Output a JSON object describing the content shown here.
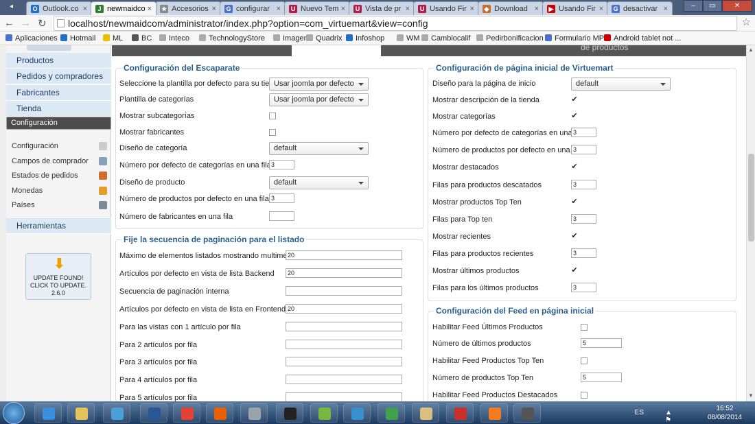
{
  "browser": {
    "tabs": [
      {
        "label": "Outlook.co",
        "color": "#1f6fc3",
        "glyph": "O"
      },
      {
        "label": "newmaidco",
        "color": "#2e7d32",
        "glyph": "J",
        "active": true
      },
      {
        "label": "Accesorios",
        "color": "#888888",
        "glyph": "★"
      },
      {
        "label": "configurar",
        "color": "#4a73c8",
        "glyph": "G"
      },
      {
        "label": "Nuevo Tem",
        "color": "#b01c48",
        "glyph": "U"
      },
      {
        "label": "Vista de pr",
        "color": "#b01c48",
        "glyph": "U"
      },
      {
        "label": "Usando Fir",
        "color": "#b01c48",
        "glyph": "U"
      },
      {
        "label": "Download",
        "color": "#c4702c",
        "glyph": "◆"
      },
      {
        "label": "Usando Fir",
        "color": "#cc0000",
        "glyph": "▶"
      },
      {
        "label": "desactivar",
        "color": "#4a73c8",
        "glyph": "G"
      }
    ],
    "url": "localhost/newmaidcom/administrator/index.php?option=com_virtuemart&view=config",
    "bookmarks": [
      {
        "label": "Aplicaciones",
        "color": "#4a73c8"
      },
      {
        "label": "Hotmail",
        "color": "#1f6fc3"
      },
      {
        "label": "ML",
        "color": "#e5c100"
      },
      {
        "label": "BC",
        "color": "#555555"
      },
      {
        "label": "Inteco",
        "color": "#aaaaaa"
      },
      {
        "label": "TechnologyStore",
        "color": "#aaaaaa"
      },
      {
        "label": "Imagen",
        "color": "#aaaaaa"
      },
      {
        "label": "Quadrix",
        "color": "#aaaaaa"
      },
      {
        "label": "Infoshop",
        "color": "#1f6fc3"
      },
      {
        "label": "WM",
        "color": "#aaaaaa"
      },
      {
        "label": "Cambiocalif",
        "color": "#aaaaaa"
      },
      {
        "label": "Pedirbonificacion",
        "color": "#aaaaaa"
      },
      {
        "label": "Formulario MP",
        "color": "#4a73c8"
      },
      {
        "label": "Android tablet not ...",
        "color": "#cc0000"
      }
    ]
  },
  "band": {
    "partial_text": "de productos"
  },
  "sidebar": {
    "nav": [
      {
        "label": "Productos"
      },
      {
        "label": "Pedidos y compradores"
      },
      {
        "label": "Fabricantes"
      },
      {
        "label": "Tienda"
      },
      {
        "label": "Configuración",
        "selected": true
      }
    ],
    "subitems": [
      {
        "label": "Configuración",
        "icon_color": "#cccccc"
      },
      {
        "label": "Campos de comprador",
        "icon_color": "#8aa0b8"
      },
      {
        "label": "Estados de pedidos",
        "icon_color": "#d07030"
      },
      {
        "label": "Monedas",
        "icon_color": "#e0a030"
      },
      {
        "label": "Países",
        "icon_color": "#7a8a9a"
      }
    ],
    "tools_label": "Herramientas",
    "update_box": {
      "line1": "UPDATE FOUND!",
      "line2": "CLICK TO UPDATE.",
      "version": "2.6.0"
    }
  },
  "escaparate": {
    "legend": "Configuración del Escaparate",
    "rows": [
      {
        "label": "Seleccione la plantilla por defecto para su tienda",
        "type": "select",
        "value": "Usar joomla por defecto"
      },
      {
        "label": "Plantilla de categorías",
        "type": "select",
        "value": "Usar joomla por defecto"
      },
      {
        "label": "Mostrar subcategorías",
        "type": "checkbox",
        "checked": false
      },
      {
        "label": "Mostrar fabricantes",
        "type": "checkbox",
        "checked": false
      },
      {
        "label": "Diseño de categoría",
        "type": "select",
        "value": "default"
      },
      {
        "label": "Número por defecto de categorías en una fila",
        "type": "input",
        "value": "3"
      },
      {
        "label": "Diseño de producto",
        "type": "select",
        "value": "default"
      },
      {
        "label": "Número de productos por defecto en una fila",
        "type": "input",
        "value": "3"
      },
      {
        "label": "Número de fabricantes en una fila",
        "type": "input",
        "value": ""
      }
    ]
  },
  "paginacion": {
    "legend": "Fije la secuencia de paginación para el listado",
    "rows": [
      {
        "label": "Máximo de elementos listados mostrando multimedia",
        "value": "20"
      },
      {
        "label": "Artículos por defecto en vista de lista Backend",
        "value": "20"
      },
      {
        "label": "Secuencia de paginación interna",
        "value": ""
      },
      {
        "label": "Artículos por defecto en vista de lista en Frontend",
        "value": "20"
      },
      {
        "label": "Para las vistas con 1 artículo por fila",
        "value": ""
      },
      {
        "label": "Para 2 artículos por fila",
        "value": ""
      },
      {
        "label": "Para 3 artículos por fila",
        "value": ""
      },
      {
        "label": "Para 4 artículos por fila",
        "value": ""
      },
      {
        "label": "Para 5 artículos por fila",
        "value": ""
      }
    ]
  },
  "inicio": {
    "legend": "Configuración de página inicial de Virtuemart",
    "rows": [
      {
        "label": "Diseño para la página de inicio",
        "type": "select",
        "value": "default"
      },
      {
        "label": "Mostrar descripción de la tienda",
        "type": "checkbox",
        "checked": true
      },
      {
        "label": "Mostrar categorías",
        "type": "checkbox",
        "checked": true
      },
      {
        "label": "Número por defecto de categorías en una fila",
        "type": "input",
        "value": "3"
      },
      {
        "label": "Número de productos por defecto en una fila",
        "type": "input",
        "value": "3"
      },
      {
        "label": "Mostrar destacados",
        "type": "checkbox",
        "checked": true
      },
      {
        "label": "Filas para productos descatados",
        "type": "input",
        "value": "3"
      },
      {
        "label": "Mostrar productos Top Ten",
        "type": "checkbox",
        "checked": true
      },
      {
        "label": "Filas para Top ten",
        "type": "input",
        "value": "3"
      },
      {
        "label": "Mostrar recientes",
        "type": "checkbox",
        "checked": true
      },
      {
        "label": "Filas para productos recientes",
        "type": "input",
        "value": "3"
      },
      {
        "label": "Mostrar últimos productos",
        "type": "checkbox",
        "checked": true
      },
      {
        "label": "Filas para los últimos productos",
        "type": "input",
        "value": "3"
      }
    ]
  },
  "feed": {
    "legend": "Configuración del Feed en página inicial",
    "rows": [
      {
        "label": "Habilitar Feed Últimos Productos",
        "type": "checkbox",
        "checked": false
      },
      {
        "label": "Número de últimos productos",
        "type": "input",
        "value": "5"
      },
      {
        "label": "Habilitar Feed Productos Top Ten",
        "type": "checkbox",
        "checked": false
      },
      {
        "label": "Número de productos Top Ten",
        "type": "input",
        "value": "5"
      },
      {
        "label": "Habilitar Feed Productos Destacados",
        "type": "checkbox",
        "checked": false
      }
    ]
  },
  "taskbar": {
    "apps": [
      {
        "name": "ie-icon",
        "color": "#3c8ddc"
      },
      {
        "name": "explorer-icon",
        "color": "#e5c15a"
      },
      {
        "name": "media-player-icon",
        "color": "#4a9fd8"
      },
      {
        "name": "word-icon",
        "color": "#2b579a"
      },
      {
        "name": "chrome-icon",
        "color": "#e34133"
      },
      {
        "name": "firefox-icon",
        "color": "#e66000"
      },
      {
        "name": "recycle-bin-icon",
        "color": "#9aa4ad"
      },
      {
        "name": "inkscape-icon",
        "color": "#222222"
      },
      {
        "name": "utorrent-icon",
        "color": "#76b83f"
      },
      {
        "name": "vuze-icon",
        "color": "#3a8fd0"
      },
      {
        "name": "messenger-icon",
        "color": "#3fa34d"
      },
      {
        "name": "vlc-icon",
        "color": "#d9c080"
      },
      {
        "name": "filezilla-icon",
        "color": "#c8302c"
      },
      {
        "name": "xampp-icon",
        "color": "#f47b20"
      },
      {
        "name": "studio-icon",
        "color": "#555555"
      }
    ],
    "lang": "ES",
    "time": "16:52",
    "date": "08/08/2014"
  }
}
